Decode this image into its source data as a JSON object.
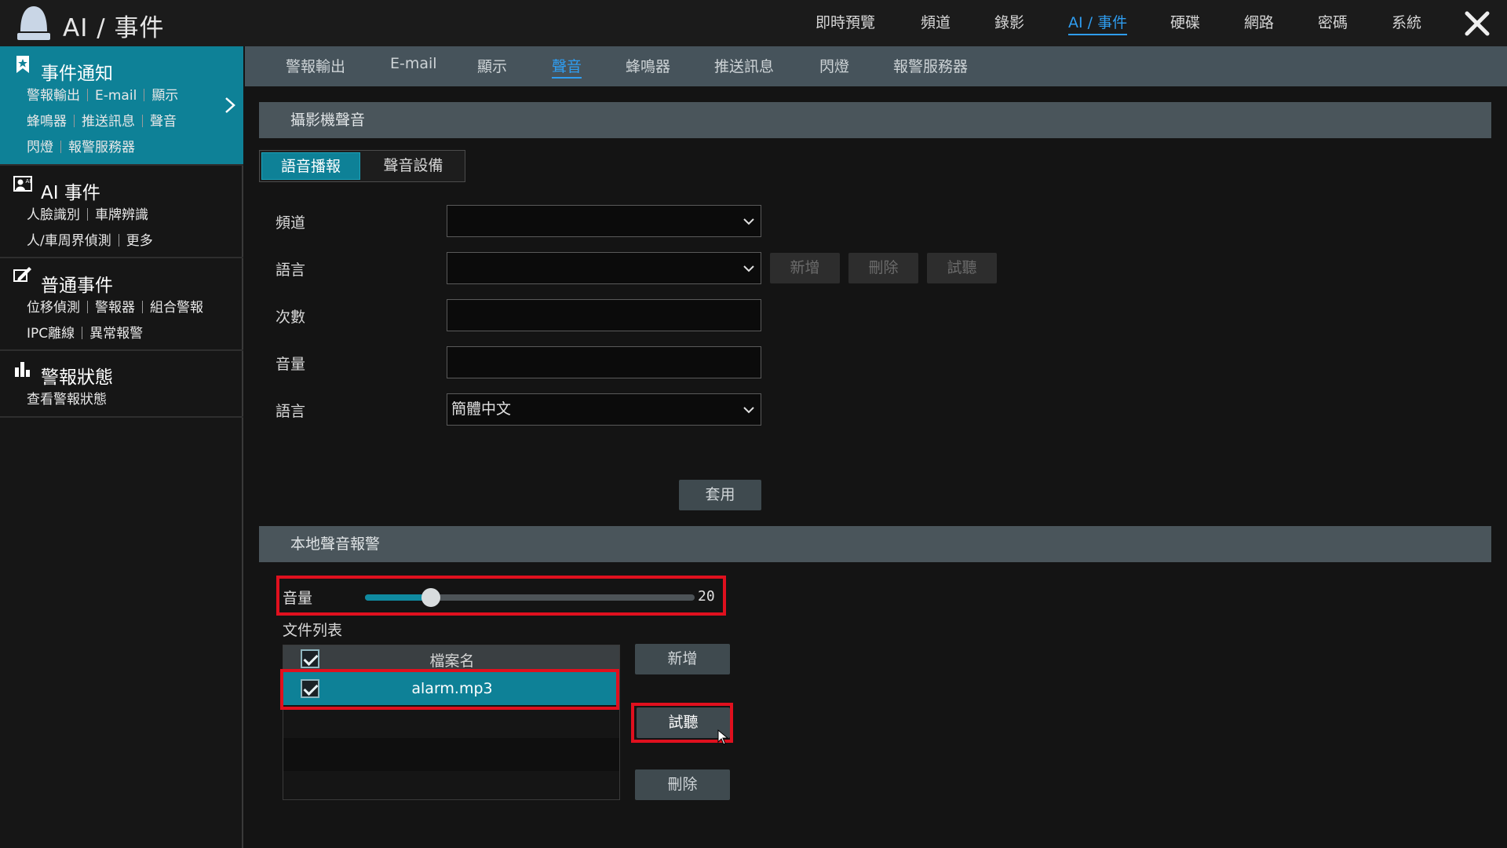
{
  "app": {
    "title": "AI / 事件",
    "logo_icon": "alarm-light-icon"
  },
  "top_nav": [
    {
      "label": "即時預覽",
      "active": false
    },
    {
      "label": "頻道",
      "active": false
    },
    {
      "label": "錄影",
      "active": false
    },
    {
      "label": "AI / 事件",
      "active": true
    },
    {
      "label": "硬碟",
      "active": false
    },
    {
      "label": "網路",
      "active": false
    },
    {
      "label": "密碼",
      "active": false
    },
    {
      "label": "系統",
      "active": false
    }
  ],
  "sidebar": {
    "groups": [
      {
        "title": "事件通知",
        "icon": "bookmark-icon",
        "active": true,
        "rows": [
          [
            "警報輸出",
            "E-mail",
            "顯示"
          ],
          [
            "蜂鳴器",
            "推送訊息",
            "聲音"
          ],
          [
            "閃燈",
            "報警服務器"
          ]
        ]
      },
      {
        "title": "AI 事件",
        "icon": "ai-face-icon",
        "active": false,
        "rows": [
          [
            "人臉識別",
            "車牌辨識"
          ],
          [
            "人/車周界偵測",
            "更多"
          ]
        ]
      },
      {
        "title": "普通事件",
        "icon": "event-pen-icon",
        "active": false,
        "rows": [
          [
            "位移偵測",
            "警報器",
            "組合警報"
          ],
          [
            "IPC離線",
            "異常報警"
          ]
        ]
      },
      {
        "title": "警報狀態",
        "icon": "bar-chart-icon",
        "active": false,
        "rows": [
          [
            "查看警報狀態"
          ]
        ]
      }
    ]
  },
  "sub_tabs": [
    {
      "label": "警報輸出",
      "active": false
    },
    {
      "label": "E-mail",
      "active": false
    },
    {
      "label": "顯示",
      "active": false
    },
    {
      "label": "聲音",
      "active": true
    },
    {
      "label": "蜂鳴器",
      "active": false
    },
    {
      "label": "推送訊息",
      "active": false
    },
    {
      "label": "閃燈",
      "active": false
    },
    {
      "label": "報警服務器",
      "active": false
    }
  ],
  "camera_sound": {
    "header": "攝影機聲音",
    "segments": {
      "active": "語音播報",
      "inactive": "聲音設備"
    },
    "labels": {
      "channel": "頻道",
      "language": "語言",
      "count": "次數",
      "volume": "音量",
      "language2": "語言"
    },
    "values": {
      "channel": "",
      "language": "",
      "count": "",
      "volume": "",
      "language2": "簡體中文"
    },
    "buttons": {
      "add": "新增",
      "delete": "刪除",
      "preview": "試聽",
      "apply": "套用"
    }
  },
  "local_alarm": {
    "header": "本地聲音報警",
    "volume_label": "音量",
    "volume_value": "20",
    "volume_fraction": 0.2,
    "file_list_label": "文件列表",
    "table_header": "檔案名",
    "files": [
      {
        "name": "alarm.mp3",
        "checked": true
      }
    ],
    "buttons": {
      "add": "新增",
      "preview": "試聽",
      "delete": "刪除"
    }
  },
  "colors": {
    "accent": "#0e8197",
    "active_link": "#2f9df0",
    "highlight": "#e0101e"
  }
}
